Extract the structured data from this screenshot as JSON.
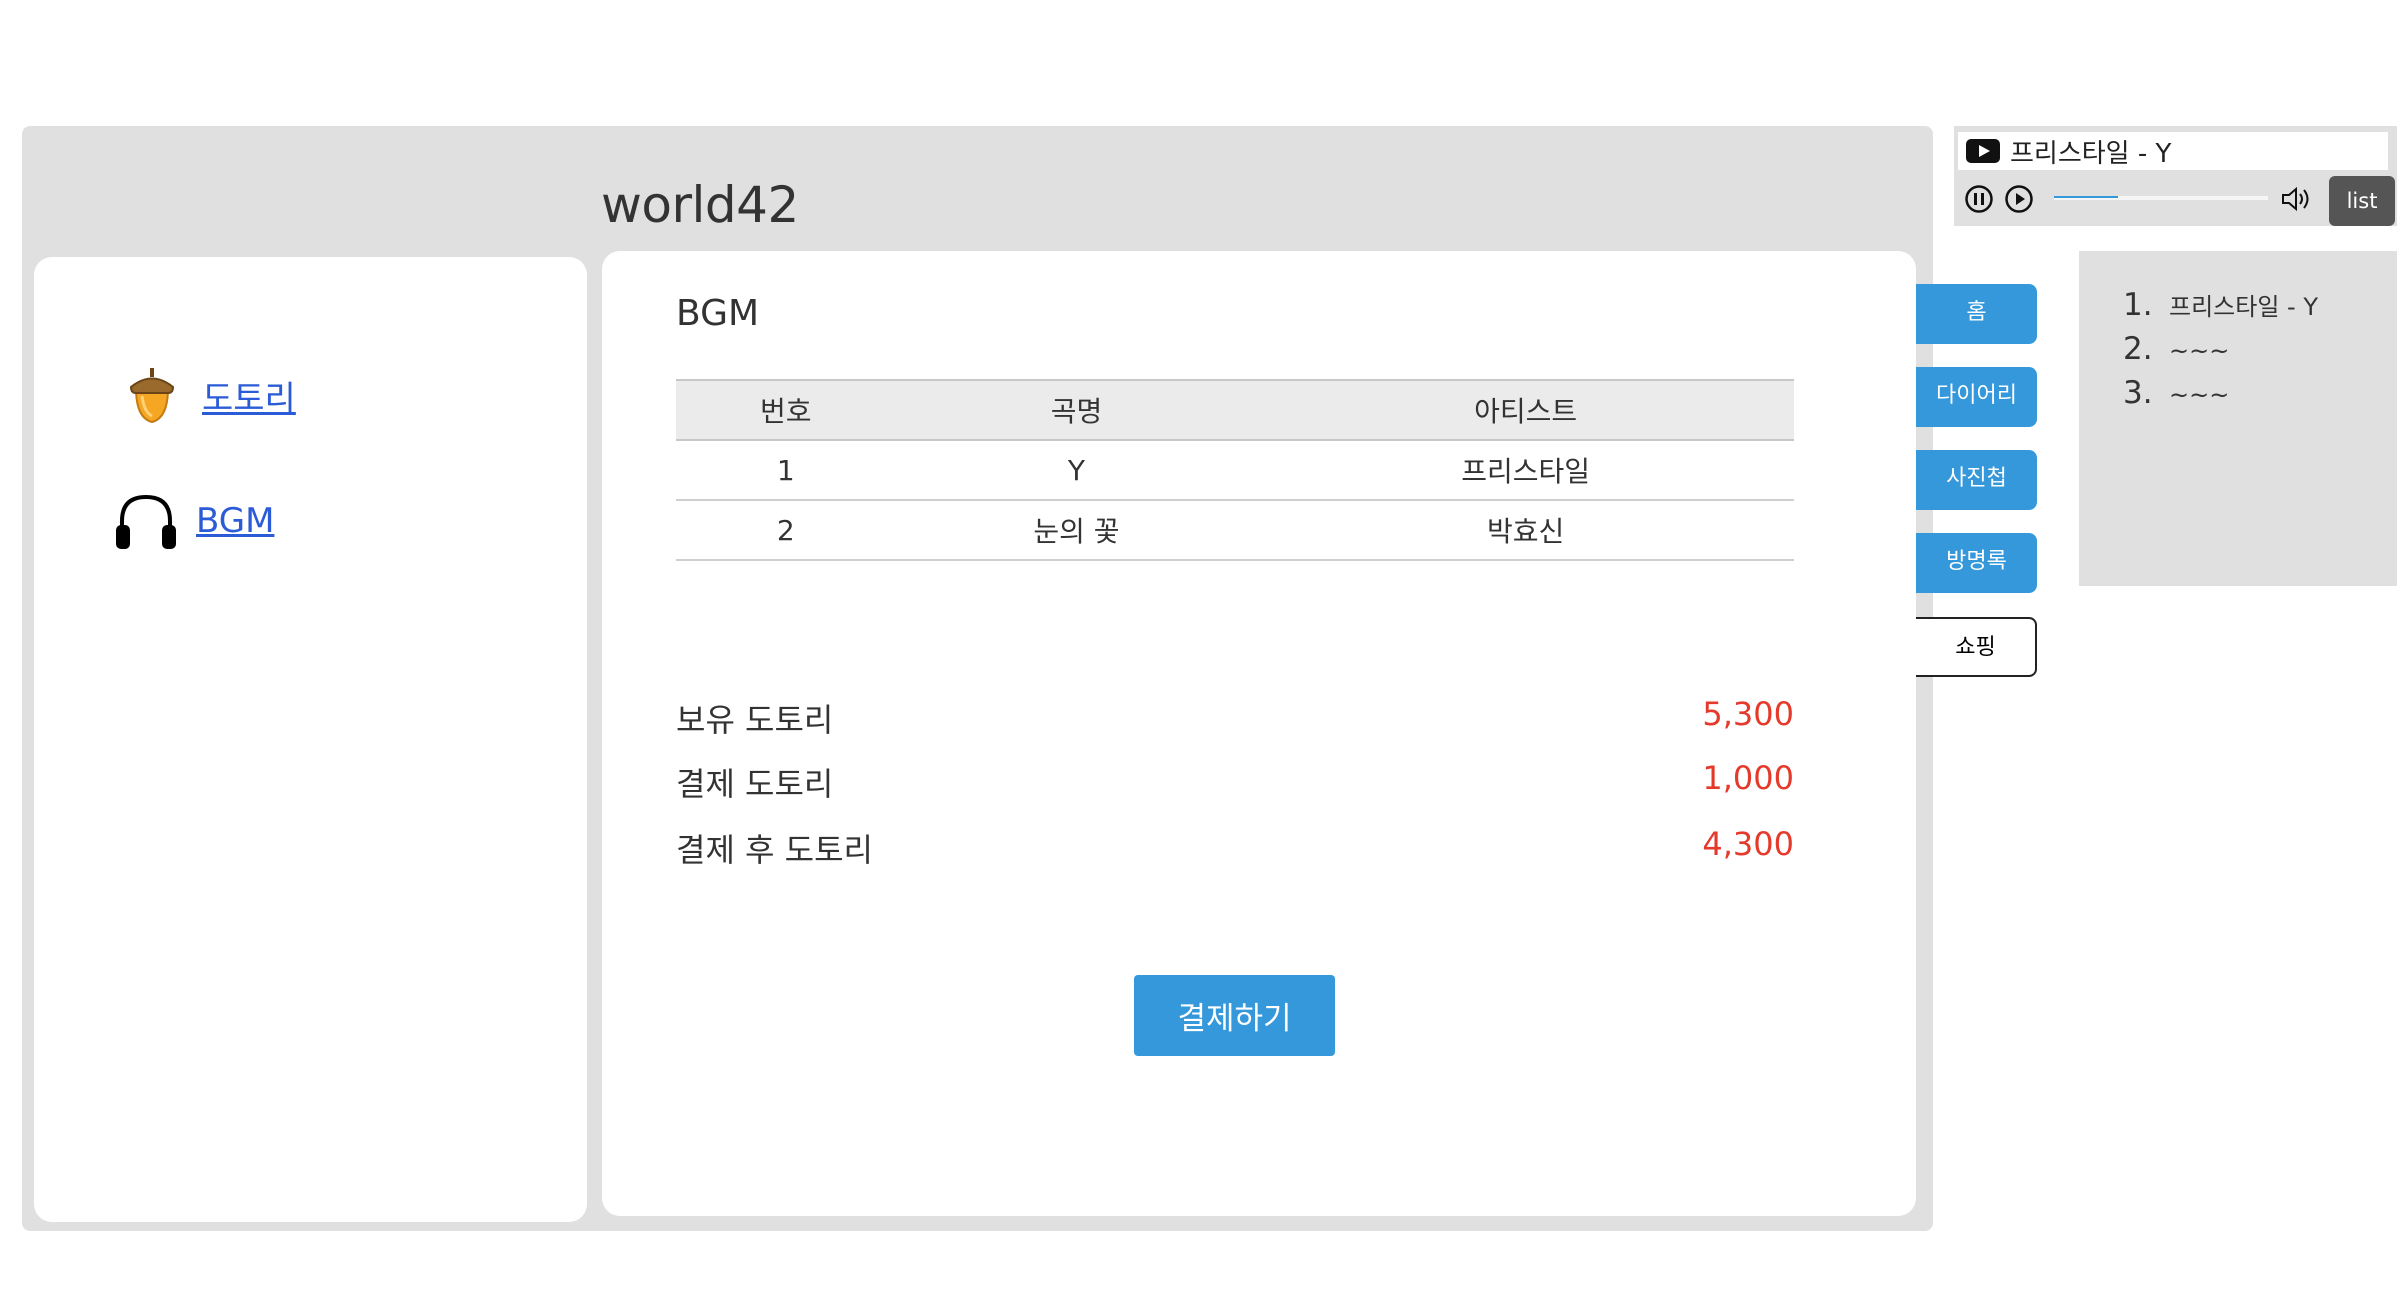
{
  "page": {
    "title": "world42"
  },
  "sidebar": {
    "items": [
      {
        "label": "도토리",
        "icon": "acorn-icon"
      },
      {
        "label": "BGM",
        "icon": "headphones-icon"
      }
    ]
  },
  "main": {
    "section_title": "BGM",
    "table": {
      "headers": [
        "번호",
        "곡명",
        "아티스트"
      ],
      "rows": [
        [
          "1",
          "Y",
          "프리스타일"
        ],
        [
          "2",
          "눈의 꽃",
          "박효신"
        ]
      ]
    },
    "summary": [
      {
        "label": "보유 도토리",
        "value": "5,300"
      },
      {
        "label": "결제 도토리",
        "value": "1,000"
      },
      {
        "label": "결제 후 도토리",
        "value": "4,300"
      }
    ],
    "pay_button": "결제하기"
  },
  "tabs": [
    {
      "label": "홈",
      "active": false
    },
    {
      "label": "다이어리",
      "active": false
    },
    {
      "label": "사진첩",
      "active": false
    },
    {
      "label": "방명록",
      "active": false
    },
    {
      "label": "쇼핑",
      "active": true
    }
  ],
  "player": {
    "now_playing": "프리스타일 - Y",
    "progress": 0.3,
    "list_label": "list"
  },
  "playlist": [
    {
      "num": "1.",
      "text": "프리스타일 - Y"
    },
    {
      "num": "2.",
      "text": "~~~"
    },
    {
      "num": "3.",
      "text": "~~~"
    }
  ],
  "colors": {
    "accent": "#3498db",
    "panel": "#e0e0e0",
    "amount": "#e53a2b",
    "link": "#2b5bd7"
  }
}
